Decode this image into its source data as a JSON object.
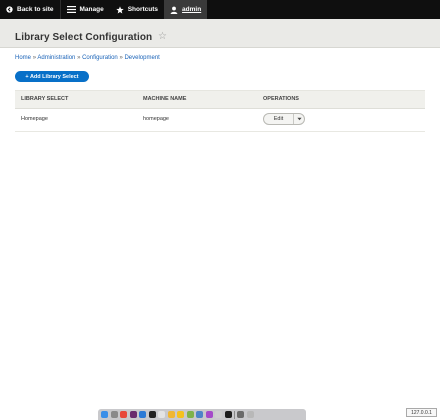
{
  "toolbar": {
    "back_label": "Back to site",
    "manage_label": "Manage",
    "shortcuts_label": "Shortcuts",
    "user_label": "admin"
  },
  "page": {
    "title": "Library Select Configuration"
  },
  "breadcrumb": {
    "items": [
      "Home",
      "Administration",
      "Configuration",
      "Development"
    ],
    "separator": "»"
  },
  "actions": {
    "add_label": "+ Add Library Select"
  },
  "table": {
    "headers": [
      "LIBRARY SELECT",
      "MACHINE NAME",
      "OPERATIONS"
    ],
    "rows": [
      {
        "name": "Homepage",
        "machine_name": "homepage",
        "operation": "Edit"
      }
    ]
  },
  "dock": {
    "apps": [
      {
        "icon": "finder-icon",
        "color": "#3b8fe8"
      },
      {
        "icon": "launchpad-icon",
        "color": "#8a8a8a"
      },
      {
        "icon": "chrome-icon",
        "color": "#e8493b"
      },
      {
        "icon": "slack-icon",
        "color": "#6a2c6d"
      },
      {
        "icon": "vscode-icon",
        "color": "#2b7ad6"
      },
      {
        "icon": "terminal-icon",
        "color": "#222222"
      },
      {
        "icon": "textedit-icon",
        "color": "#e3e3e3"
      },
      {
        "icon": "photos-icon",
        "color": "#f0b632"
      },
      {
        "icon": "sketch-icon",
        "color": "#f5c11e"
      },
      {
        "icon": "preview-icon",
        "color": "#7fb24a"
      },
      {
        "icon": "app-icon",
        "color": "#4d84c8"
      },
      {
        "icon": "phpstorm-icon",
        "color": "#a54ac9"
      },
      {
        "icon": "notes-icon",
        "color": "#cfcfcf"
      },
      {
        "icon": "iterm-icon",
        "color": "#1d1d1d"
      },
      {
        "icon": "downloads-icon",
        "color": "#6a6a6a"
      },
      {
        "icon": "trash-icon",
        "color": "#b8b8b8"
      }
    ]
  },
  "status": {
    "host": "127.0.0.1"
  }
}
